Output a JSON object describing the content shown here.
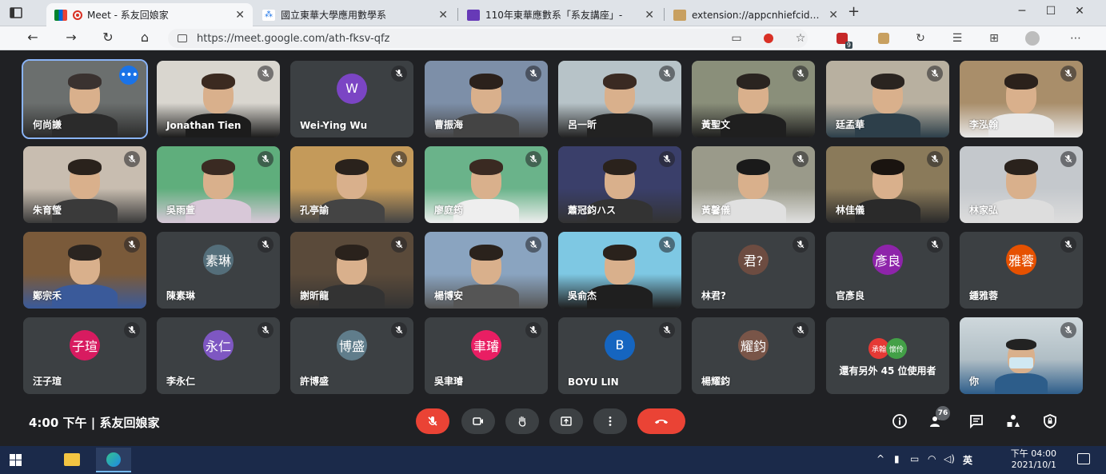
{
  "browser": {
    "tabs": [
      {
        "title": "Meet - 系友回娘家",
        "active": true
      },
      {
        "title": "國立東華大學應用數學系",
        "active": false
      },
      {
        "title": "110年東華應數系「系友講座」-",
        "active": false
      },
      {
        "title": "extension://appcnhiefcidcldjeal",
        "active": false
      }
    ],
    "url": "https://meet.google.com/ath-fksv-qfz",
    "extension_badge": "9"
  },
  "meet": {
    "participants": [
      {
        "name": "何尚謙",
        "type": "video",
        "selected": true
      },
      {
        "name": "Jonathan Tien",
        "type": "video"
      },
      {
        "name": "Wei-Ying Wu",
        "type": "avatar",
        "initial": "W",
        "color": "#7b45c4"
      },
      {
        "name": "曹振海",
        "type": "video"
      },
      {
        "name": "呂一昕",
        "type": "video"
      },
      {
        "name": "黃聖文",
        "type": "video"
      },
      {
        "name": "廷孟華",
        "type": "video"
      },
      {
        "name": "李泓翰",
        "type": "video"
      },
      {
        "name": "朱育瑩",
        "type": "video"
      },
      {
        "name": "吳雨萱",
        "type": "video"
      },
      {
        "name": "孔亭諭",
        "type": "video"
      },
      {
        "name": "廖庭筠",
        "type": "video"
      },
      {
        "name": "蕭冠鈞ハス",
        "type": "video"
      },
      {
        "name": "黃馨儀",
        "type": "video"
      },
      {
        "name": "林佳儀",
        "type": "video"
      },
      {
        "name": "林家弘",
        "type": "video"
      },
      {
        "name": "鄭宗禾",
        "type": "video"
      },
      {
        "name": "陳素琳",
        "type": "avatar",
        "initial": "素琳",
        "color": "#546e7a"
      },
      {
        "name": "謝昕龍",
        "type": "video"
      },
      {
        "name": "楊博安",
        "type": "video"
      },
      {
        "name": "吳俞杰",
        "type": "video"
      },
      {
        "name": "林君?",
        "type": "avatar",
        "initial": "君?",
        "color": "#6d4c41"
      },
      {
        "name": "官彥良",
        "type": "avatar",
        "initial": "彥良",
        "color": "#8e24aa"
      },
      {
        "name": "鍾雅蓉",
        "type": "avatar",
        "initial": "雅蓉",
        "color": "#e65100"
      },
      {
        "name": "汪子瑄",
        "type": "avatar",
        "initial": "子瑄",
        "color": "#d81b60"
      },
      {
        "name": "李永仁",
        "type": "avatar",
        "initial": "永仁",
        "color": "#7e57c2"
      },
      {
        "name": "許博盛",
        "type": "avatar",
        "initial": "博盛",
        "color": "#607d8b"
      },
      {
        "name": "吳聿璿",
        "type": "avatar",
        "initial": "聿璿",
        "color": "#e91e63"
      },
      {
        "name": "BOYU LIN",
        "type": "avatar",
        "initial": "B",
        "color": "#1565c0"
      },
      {
        "name": "楊耀鈞",
        "type": "avatar",
        "initial": "耀鈞",
        "color": "#795548"
      }
    ],
    "others": {
      "label": "還有另外 45 位使用者",
      "chips": [
        "承翰",
        "懷伶"
      ]
    },
    "self_label": "你",
    "meeting_info": "4:00 下午  |  系友回娘家",
    "people_count": "76"
  },
  "taskbar": {
    "ime": "英",
    "time": "下午 04:00",
    "date": "2021/10/1"
  }
}
